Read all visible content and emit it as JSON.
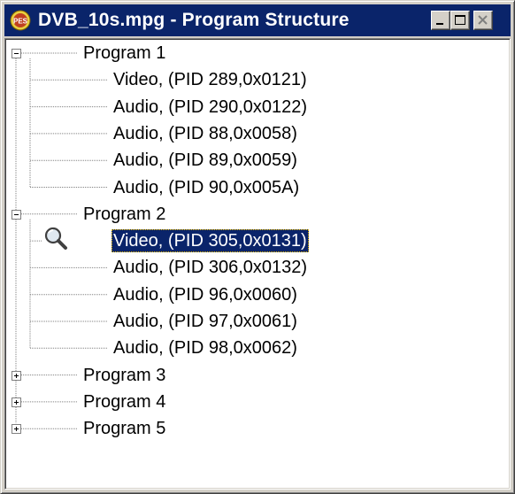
{
  "window": {
    "title": "DVB_10s.mpg - Program Structure",
    "icon": "pes-app-icon"
  },
  "titlebar_buttons": [
    "minimize",
    "maximize",
    "close"
  ],
  "tree": {
    "programs": [
      {
        "label": "Program 1",
        "expanded": true,
        "children": [
          {
            "label": "Video,  (PID 289,0x0121)"
          },
          {
            "label": "Audio,  (PID 290,0x0122)"
          },
          {
            "label": "Audio,  (PID 88,0x0058)"
          },
          {
            "label": "Audio,  (PID 89,0x0059)"
          },
          {
            "label": "Audio,  (PID 90,0x005A)"
          }
        ]
      },
      {
        "label": "Program 2",
        "expanded": true,
        "children": [
          {
            "label": "Video,  (PID 305,0x0131)",
            "selected": true,
            "icon": "magnifier-icon"
          },
          {
            "label": "Audio,  (PID 306,0x0132)"
          },
          {
            "label": "Audio,  (PID 96,0x0060)"
          },
          {
            "label": "Audio,  (PID 97,0x0061)"
          },
          {
            "label": "Audio,  (PID 98,0x0062)"
          }
        ]
      },
      {
        "label": "Program 3",
        "expanded": false,
        "children": []
      },
      {
        "label": "Program 4",
        "expanded": false,
        "children": []
      },
      {
        "label": "Program 5",
        "expanded": false,
        "children": []
      }
    ]
  },
  "colors": {
    "titlebar": "#0a246a",
    "selection": "#0a246a",
    "face": "#d4d0c8"
  }
}
